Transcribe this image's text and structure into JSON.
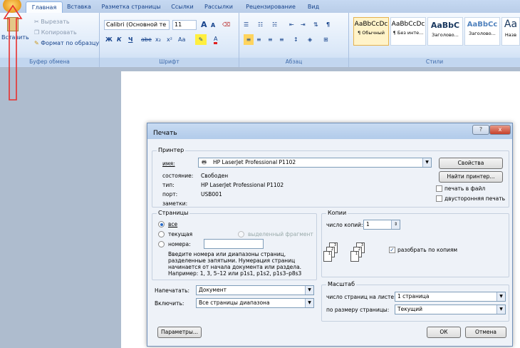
{
  "ribbon": {
    "tabs": [
      "Главная",
      "Вставка",
      "Разметка страницы",
      "Ссылки",
      "Рассылки",
      "Рецензирование",
      "Вид"
    ],
    "clipboard": {
      "paste": "Вставить",
      "cut": "Вырезать",
      "copy": "Копировать",
      "format": "Формат по образцу",
      "group": "Буфер обмена"
    },
    "font": {
      "name": "Calibri (Основной те",
      "size": "11",
      "group": "Шрифт",
      "bold": "Ж",
      "italic": "К",
      "underline": "Ч",
      "strike": "abe",
      "sub": "x₂",
      "sup": "x²",
      "case": "Aa",
      "grow": "A",
      "shrink": "A"
    },
    "paragraph": {
      "group": "Абзац"
    },
    "styles": {
      "group": "Стили",
      "items": [
        {
          "sample": "AaBbCcDc",
          "name": "¶ Обычный"
        },
        {
          "sample": "AaBbCcDc",
          "name": "¶ Без инте..."
        },
        {
          "sample": "AaBbC",
          "name": "Заголово..."
        },
        {
          "sample": "AaBbCc",
          "name": "Заголово..."
        },
        {
          "sample": "Аа",
          "name": "Назв"
        }
      ]
    }
  },
  "dialog": {
    "title": "Печать",
    "printer": {
      "legend": "Принтер",
      "name_label": "имя:",
      "name_value": "HP LaserJet Professional P1102",
      "props_button": "Свойства",
      "find_button": "Найти принтер...",
      "status_label": "состояние:",
      "status_value": "Свободен",
      "type_label": "тип:",
      "type_value": "HP LaserJet Professional P1102",
      "port_label": "порт:",
      "port_value": "USB001",
      "notes_label": "заметки:",
      "print_to_file": "печать в файл",
      "duplex": "двусторонняя печать"
    },
    "pages": {
      "legend": "Страницы",
      "all": "все",
      "current": "текущая",
      "selection": "выделенный фрагмент",
      "numbers": "номера:",
      "hint": [
        "Введите номера или диапазоны страниц,",
        "разделенные запятыми. Нумерация страниц",
        "начинается от начала документа или раздела.",
        "Например: 1, 3, 5–12 или p1s1, p1s2, p1s3–p8s3"
      ]
    },
    "copies": {
      "legend": "Копии",
      "count_label": "число копий:",
      "count_value": "1",
      "collate": "разобрать по копиям"
    },
    "print_what": {
      "label": "Напечатать:",
      "value": "Документ"
    },
    "include": {
      "label": "Включить:",
      "value": "Все страницы диапазона"
    },
    "zoom": {
      "legend": "Масштаб",
      "per_sheet_label": "число страниц на листе:",
      "per_sheet_value": "1 страница",
      "scale_label": "по размеру страницы:",
      "scale_value": "Текущий"
    },
    "options_button": "Параметры...",
    "ok": "ОК",
    "cancel": "Отмена",
    "help": "?",
    "close": "x"
  }
}
